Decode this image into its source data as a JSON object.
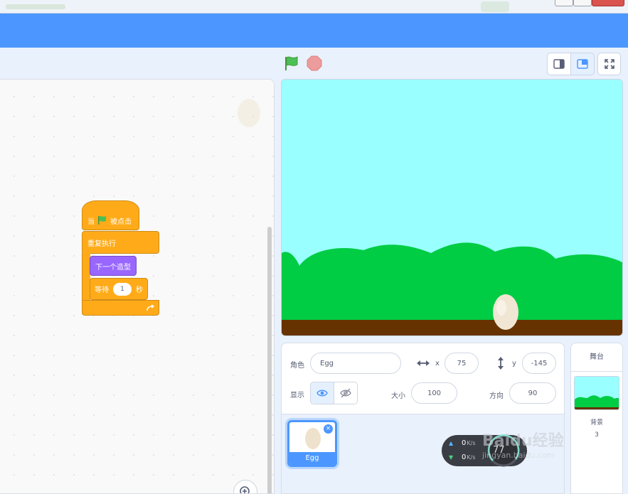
{
  "colors": {
    "menubar": "#4c97ff",
    "motion_blue": "#4c97ff",
    "control_orange": "#ffab19",
    "looks_purple": "#9966ff",
    "stage_sky": "#99ffff",
    "stage_grass": "#00cc44",
    "stage_ground": "#663300"
  },
  "stage_header": {
    "flag_icon": "green-flag-icon",
    "stop_icon": "stop-icon"
  },
  "blocks": {
    "hat": {
      "when": "当",
      "clicked": "被点击"
    },
    "forever": "重复执行",
    "next_costume": "下一个造型",
    "wait": {
      "label": "等待",
      "value": "1",
      "unit": "秒"
    }
  },
  "sprite_info": {
    "sprite_label": "角色",
    "sprite_name": "Egg",
    "x_label": "x",
    "x_value": "75",
    "y_label": "y",
    "y_value": "-145",
    "show_label": "显示",
    "size_label": "大小",
    "size_value": "100",
    "direction_label": "方向",
    "direction_value": "90"
  },
  "sprite_list": [
    {
      "name": "Egg",
      "selected": true
    }
  ],
  "stage_panel": {
    "title": "舞台",
    "backdrop_label": "背景",
    "backdrop_count": "3"
  },
  "net_widget": {
    "up_value": "0",
    "up_unit": "K/s",
    "down_value": "0",
    "down_unit": "K/s",
    "percent": "77"
  },
  "watermark": {
    "brand": "Baidu经验",
    "url": "jingyan.baidu.com"
  }
}
